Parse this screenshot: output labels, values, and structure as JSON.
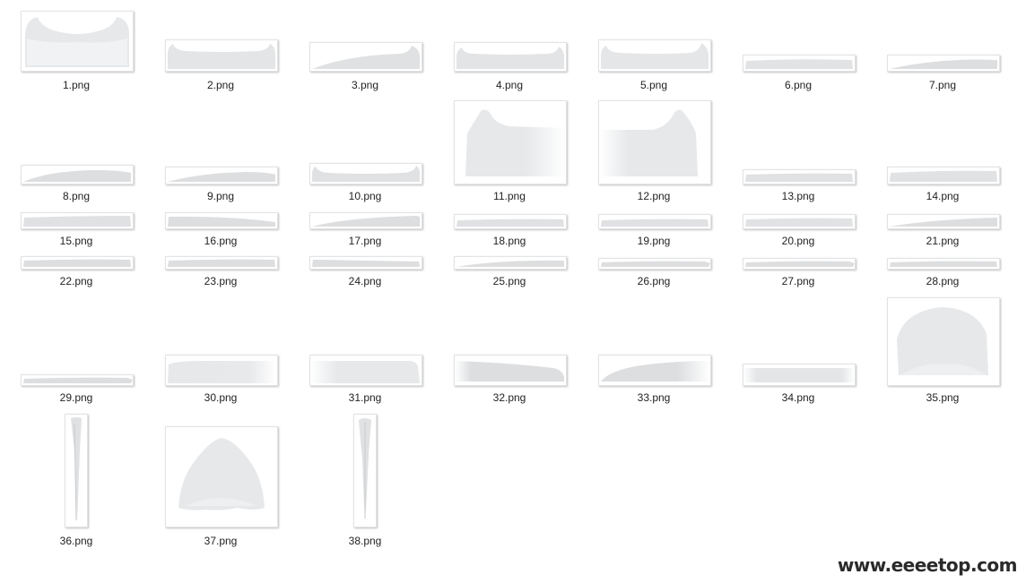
{
  "files": [
    {
      "name": "1.png",
      "shape": "snow-cap-ears"
    },
    {
      "name": "2.png",
      "shape": "snow-bar-ears"
    },
    {
      "name": "3.png",
      "shape": "snow-arch-right-ear"
    },
    {
      "name": "4.png",
      "shape": "snow-bar-ears"
    },
    {
      "name": "5.png",
      "shape": "snow-bar-ears"
    },
    {
      "name": "6.png",
      "shape": "snow-strip"
    },
    {
      "name": "7.png",
      "shape": "snow-arch"
    },
    {
      "name": "8.png",
      "shape": "snow-arch"
    },
    {
      "name": "9.png",
      "shape": "snow-arch"
    },
    {
      "name": "10.png",
      "shape": "snow-bar-ears"
    },
    {
      "name": "11.png",
      "shape": "snow-block-left-peak"
    },
    {
      "name": "12.png",
      "shape": "snow-block-right-peak"
    },
    {
      "name": "13.png",
      "shape": "snow-strip"
    },
    {
      "name": "14.png",
      "shape": "snow-strip"
    },
    {
      "name": "15.png",
      "shape": "snow-strip"
    },
    {
      "name": "16.png",
      "shape": "snow-arch"
    },
    {
      "name": "17.png",
      "shape": "snow-arch"
    },
    {
      "name": "18.png",
      "shape": "snow-strip"
    },
    {
      "name": "19.png",
      "shape": "snow-strip"
    },
    {
      "name": "20.png",
      "shape": "snow-strip"
    },
    {
      "name": "21.png",
      "shape": "snow-arch"
    },
    {
      "name": "22.png",
      "shape": "snow-strip"
    },
    {
      "name": "23.png",
      "shape": "snow-strip"
    },
    {
      "name": "24.png",
      "shape": "snow-strip"
    },
    {
      "name": "25.png",
      "shape": "snow-arch"
    },
    {
      "name": "26.png",
      "shape": "snow-strip"
    },
    {
      "name": "27.png",
      "shape": "snow-strip"
    },
    {
      "name": "28.png",
      "shape": "snow-strip"
    },
    {
      "name": "29.png",
      "shape": "snow-strip"
    },
    {
      "name": "30.png",
      "shape": "snow-fade-bar"
    },
    {
      "name": "31.png",
      "shape": "snow-fade-bar"
    },
    {
      "name": "32.png",
      "shape": "snow-wedge"
    },
    {
      "name": "33.png",
      "shape": "snow-arch-fade"
    },
    {
      "name": "34.png",
      "shape": "snow-fade-bar"
    },
    {
      "name": "35.png",
      "shape": "snow-dome"
    },
    {
      "name": "36.png",
      "shape": "icicle"
    },
    {
      "name": "37.png",
      "shape": "snow-peak"
    },
    {
      "name": "38.png",
      "shape": "icicle"
    }
  ],
  "watermark": "www.eeeetop.com"
}
